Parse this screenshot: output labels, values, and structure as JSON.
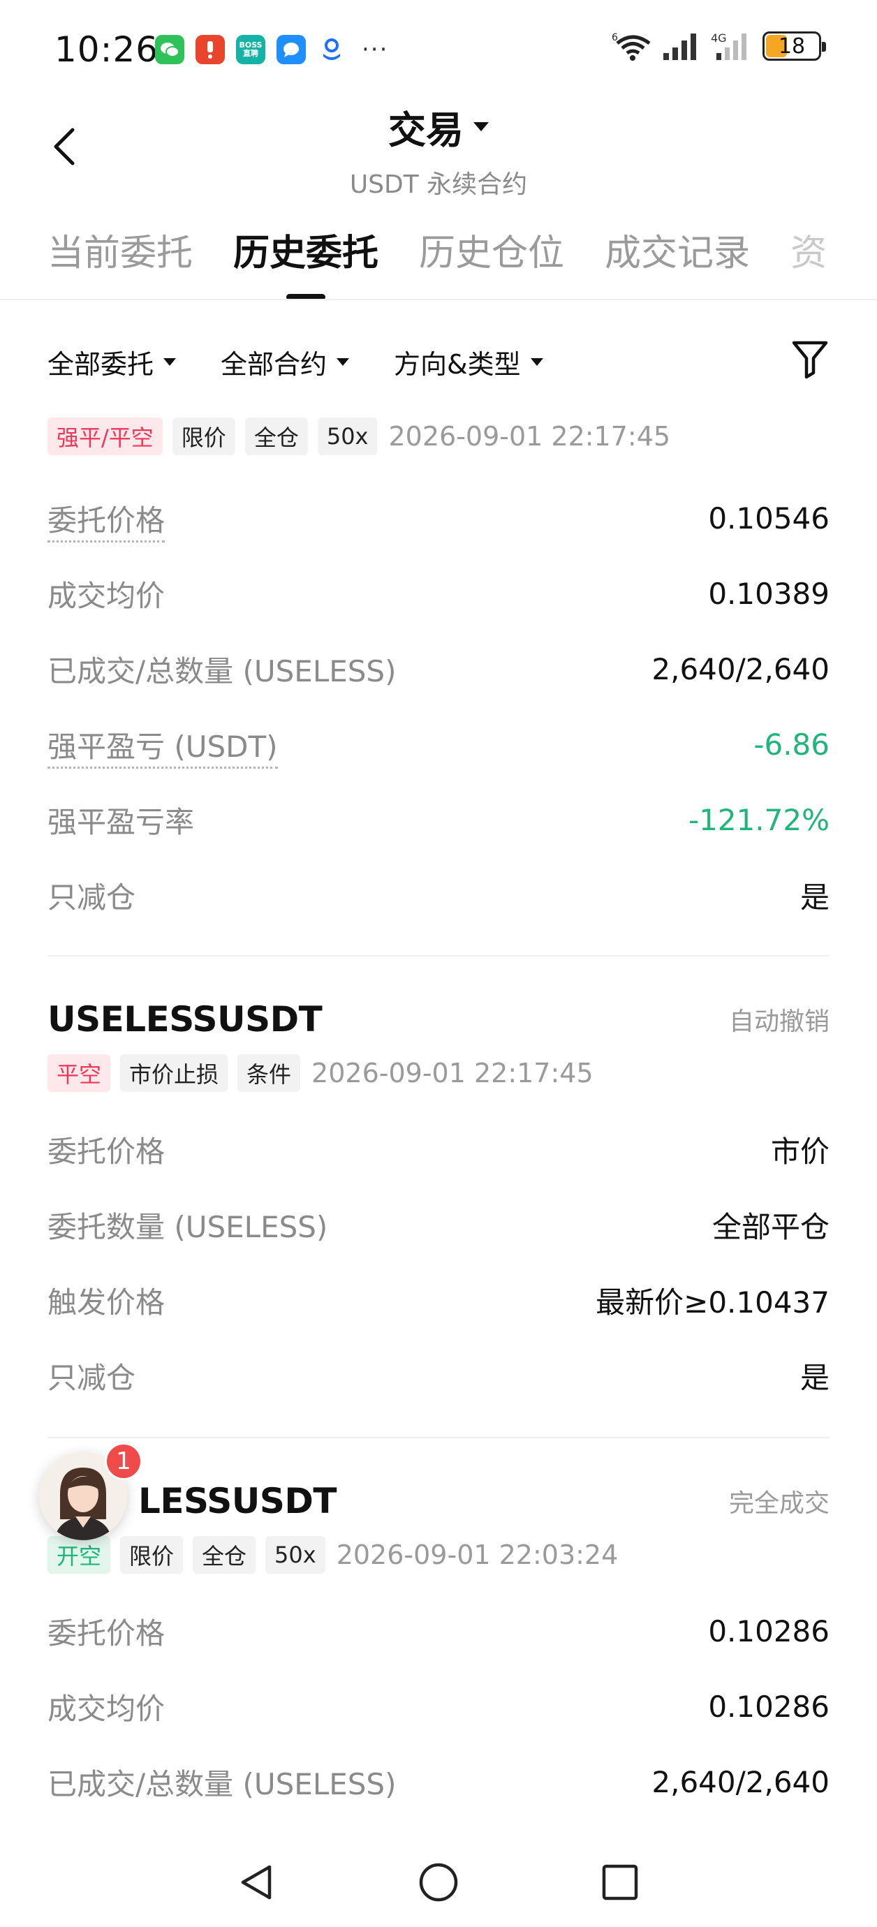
{
  "status_bar": {
    "time": "10:26",
    "notification_icons": [
      "wechat-icon",
      "alert-app-icon",
      "boss-zhipin-icon",
      "message-icon",
      "browser-icon"
    ],
    "boss_label": "BOSS直聘",
    "more": "···",
    "wifi_sub": "6",
    "cell_label": "4G",
    "battery": "18"
  },
  "header": {
    "title": "交易",
    "subtitle": "USDT 永续合约"
  },
  "tabs": [
    "当前委托",
    "历史委托",
    "历史仓位",
    "成交记录",
    "资"
  ],
  "active_tab": 1,
  "filters": {
    "orders": "全部委托",
    "contracts": "全部合约",
    "direction": "方向&类型"
  },
  "orders": [
    {
      "tags": [
        "强平/平空",
        "限价",
        "全仓",
        "50x"
      ],
      "time": "2026-09-01 22:17:45",
      "rows": [
        {
          "label": "委托价格",
          "value": "0.10546"
        },
        {
          "label": "成交均价",
          "value": "0.10389"
        },
        {
          "label": "已成交/总数量 (USELESS)",
          "value": "2,640/2,640"
        },
        {
          "label": "强平盈亏 (USDT)",
          "value": "-6.86"
        },
        {
          "label": "强平盈亏率",
          "value": "-121.72%"
        },
        {
          "label": "只减仓",
          "value": "是"
        }
      ]
    },
    {
      "symbol": "USELESSUSDT",
      "status": "自动撤销",
      "tags": [
        "平空",
        "市价止损",
        "条件"
      ],
      "time": "2026-09-01 22:17:45",
      "rows": [
        {
          "label": "委托价格",
          "value": "市价"
        },
        {
          "label": "委托数量 (USELESS)",
          "value": "全部平仓"
        },
        {
          "label": "触发价格",
          "value": "最新价≥0.10437"
        },
        {
          "label": "只减仓",
          "value": "是"
        }
      ]
    },
    {
      "symbol": "LESSUSDT",
      "status": "完全成交",
      "tags": [
        "开空",
        "限价",
        "全仓",
        "50x"
      ],
      "time": "2026-09-01 22:03:24",
      "rows": [
        {
          "label": "委托价格",
          "value": "0.10286"
        },
        {
          "label": "成交均价",
          "value": "0.10286"
        },
        {
          "label": "已成交/总数量 (USELESS)",
          "value": "2,640/2,640"
        }
      ]
    }
  ],
  "assistant_badge": "1",
  "colors": {
    "red": "#ea3a5a",
    "green": "#1fb57b",
    "muted": "#8a8a8a",
    "battery": "#f5a623"
  }
}
